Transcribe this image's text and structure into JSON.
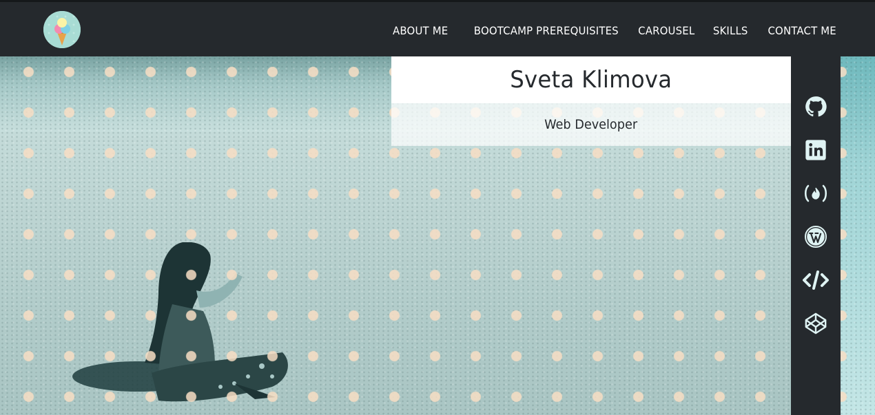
{
  "navbar": {
    "logo_icon": "ice-cream-cone-icon",
    "links": [
      {
        "label": "ABOUT ME"
      },
      {
        "label": "BOOTCAMP PREREQUISITES"
      },
      {
        "label": "CAROUSEL"
      },
      {
        "label": "SKILLS"
      },
      {
        "label": "CONTACT ME"
      }
    ]
  },
  "hero": {
    "name": "Sveta Klimova",
    "role": "Web Developer",
    "photo_subject": "woman sitting on beach sand"
  },
  "social": {
    "icons": [
      "github-icon",
      "linkedin-icon",
      "freecodecamp-icon",
      "wordpress-icon",
      "code-icon",
      "codepen-icon"
    ]
  },
  "colors": {
    "dark": "#25292d",
    "white": "#ffffff",
    "dot": "#f8dec4",
    "tint": "#b6d6d4"
  }
}
